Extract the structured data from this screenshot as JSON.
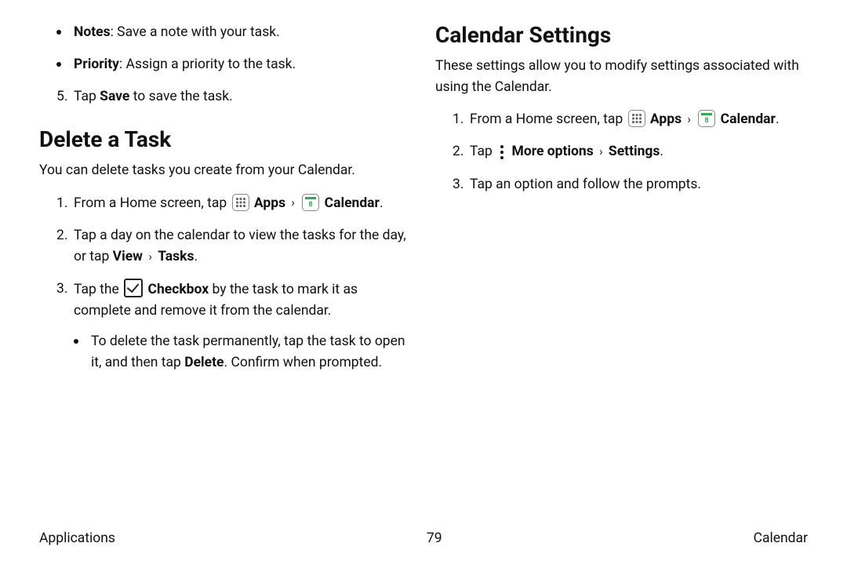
{
  "left": {
    "bullets": [
      {
        "label": "Notes",
        "text": ": Save a note with your task."
      },
      {
        "label": "Priority",
        "text": ": Assign a priority to the task."
      }
    ],
    "step5_pre": "Tap ",
    "step5_b": "Save",
    "step5_post": " to save the task.",
    "delete_heading": "Delete a Task",
    "delete_intro": "You can delete tasks you create from your Calendar.",
    "d1_pre": "From a Home screen, tap ",
    "d1_apps": "Apps",
    "d1_cal": "Calendar",
    "d2_a": "Tap a day on the calendar to view the tasks for the day, or tap ",
    "d2_b": "View",
    "d2_c": "Tasks",
    "d3_a": "Tap the ",
    "d3_b": "Checkbox",
    "d3_c": " by the task to mark it as complete and remove it from the calendar.",
    "d3_sub_a": "To delete the task permanently, tap the task to open it, and then tap ",
    "d3_sub_b": "Delete",
    "d3_sub_c": ". Confirm when prompted."
  },
  "right": {
    "heading": "Calendar Settings",
    "intro": "These settings allow you to modify settings associated with using the Calendar.",
    "s1_pre": "From a Home screen, tap ",
    "s1_apps": "Apps",
    "s1_cal": "Calendar",
    "s2_a": "Tap ",
    "s2_b": "More options",
    "s2_c": "Settings",
    "s3": "Tap an option and follow the prompts."
  },
  "footer": {
    "left": "Applications",
    "center": "79",
    "right": "Calendar"
  },
  "nums": {
    "n1": "1.",
    "n2": "2.",
    "n3": "3.",
    "n5": "5."
  },
  "period": ".",
  "chev": "›"
}
